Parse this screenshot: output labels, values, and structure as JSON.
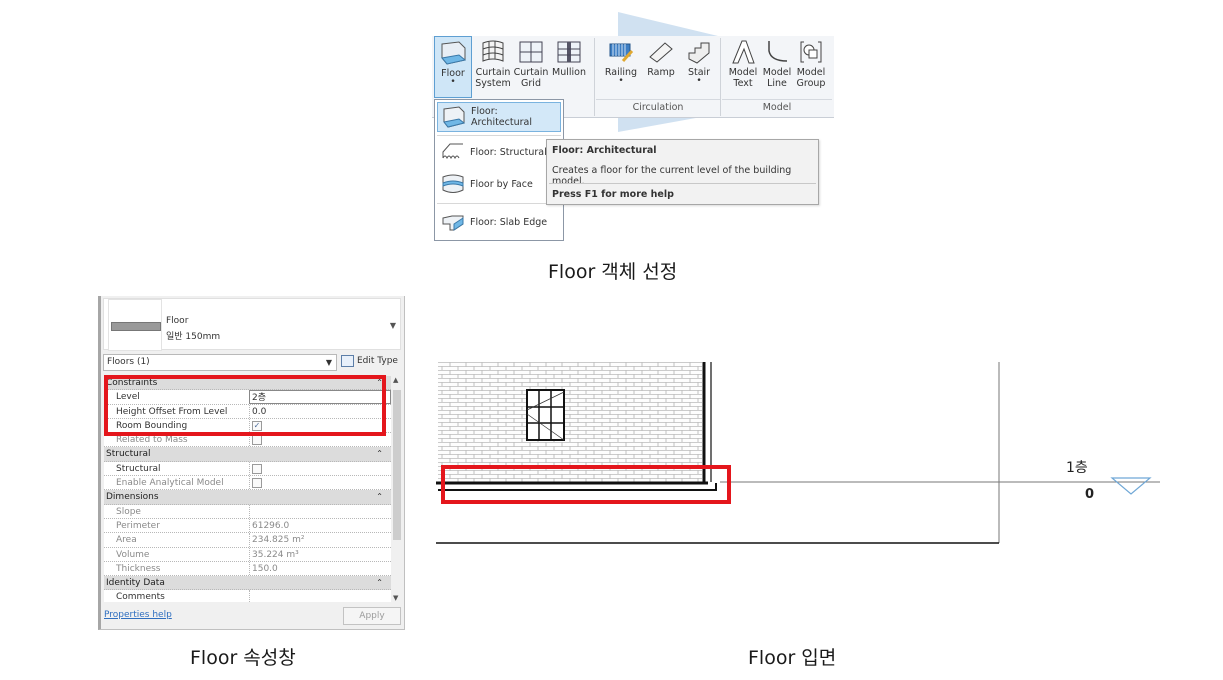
{
  "captions": {
    "select": "Floor 객체 선정",
    "properties": "Floor 속성창",
    "elevation": "Floor 입면"
  },
  "ribbon": {
    "buttons": [
      {
        "label1": "Floor",
        "label2": "",
        "icon": "floor-icon",
        "dropdown": true,
        "active": true
      },
      {
        "label1": "Curtain",
        "label2": "System",
        "icon": "curtain-system-icon"
      },
      {
        "label1": "Curtain",
        "label2": "Grid",
        "icon": "curtain-grid-icon"
      },
      {
        "label1": "Mullion",
        "label2": "",
        "icon": "mullion-icon"
      },
      {
        "label1": "Railing",
        "label2": "",
        "icon": "railing-icon",
        "dropdown": true
      },
      {
        "label1": "Ramp",
        "label2": "",
        "icon": "ramp-icon"
      },
      {
        "label1": "Stair",
        "label2": "",
        "icon": "stair-icon",
        "dropdown": true
      },
      {
        "label1": "Model",
        "label2": "Text",
        "icon": "model-text-icon"
      },
      {
        "label1": "Model",
        "label2": "Line",
        "icon": "model-line-icon"
      },
      {
        "label1": "Model",
        "label2": "Group",
        "icon": "model-group-icon",
        "dropdown": true
      }
    ],
    "groups": [
      "Circulation",
      "Model"
    ]
  },
  "floor_menu": {
    "items": [
      {
        "label": "Floor: Architectural",
        "icon": "floor-architectural-icon",
        "highlighted": true
      },
      {
        "label": "Floor: Structural",
        "icon": "floor-structural-icon"
      },
      {
        "label": "Floor by Face",
        "icon": "floor-by-face-icon"
      },
      {
        "label": "Floor: Slab Edge",
        "icon": "slab-edge-icon"
      }
    ]
  },
  "tooltip": {
    "title": "Floor: Architectural",
    "description": "Creates a floor for the current level of the building model.",
    "help": "Press F1 for more help"
  },
  "properties": {
    "type_family": "Floor",
    "type_name": "일반 150mm",
    "instance_filter": "Floors (1)",
    "edit_type_label": "Edit Type",
    "rows": [
      {
        "kind": "cat",
        "label": "Constraints"
      },
      {
        "kind": "prop",
        "key": "Level",
        "value": "2층",
        "editing": true
      },
      {
        "kind": "prop",
        "key": "Height Offset From Level",
        "value": "0.0"
      },
      {
        "kind": "prop",
        "key": "Room Bounding",
        "check": true
      },
      {
        "kind": "prop",
        "key": "Related to Mass",
        "check": false,
        "readonly": true
      },
      {
        "kind": "cat",
        "label": "Structural"
      },
      {
        "kind": "prop",
        "key": "Structural",
        "check": false
      },
      {
        "kind": "prop",
        "key": "Enable Analytical Model",
        "check": false,
        "readonly": true
      },
      {
        "kind": "cat",
        "label": "Dimensions"
      },
      {
        "kind": "prop",
        "key": "Slope",
        "value": "",
        "readonly": true
      },
      {
        "kind": "prop",
        "key": "Perimeter",
        "value": "61296.0",
        "readonly": true
      },
      {
        "kind": "prop",
        "key": "Area",
        "value": "234.825 m²",
        "readonly": true
      },
      {
        "kind": "prop",
        "key": "Volume",
        "value": "35.224 m³",
        "readonly": true
      },
      {
        "kind": "prop",
        "key": "Thickness",
        "value": "150.0",
        "readonly": true
      },
      {
        "kind": "cat",
        "label": "Identity Data"
      },
      {
        "kind": "prop",
        "key": "Comments",
        "value": ""
      }
    ],
    "help_link": "Properties help",
    "apply_label": "Apply"
  },
  "elevation": {
    "level_name": "1층",
    "level_elevation": "0"
  },
  "colors": {
    "highlight_red": "#e4161c",
    "ribbon_active": "#cfe6f7",
    "link_blue": "#2f6fc0"
  }
}
